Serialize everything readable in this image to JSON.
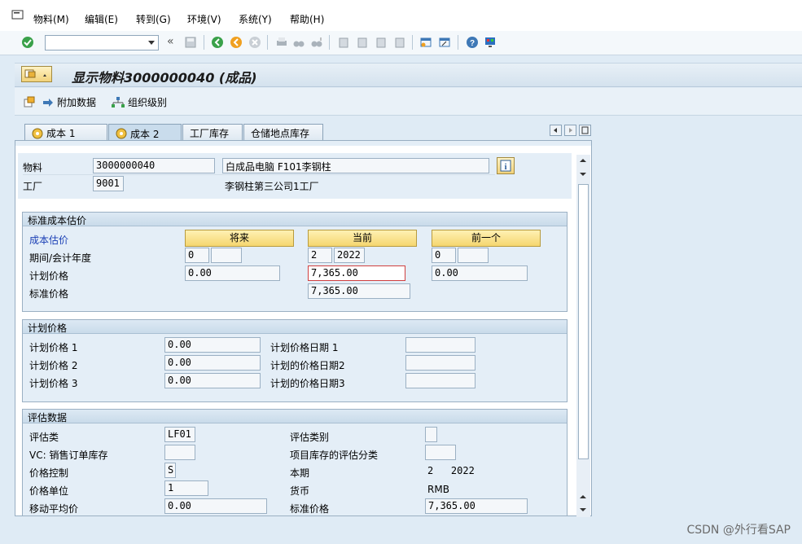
{
  "menu": [
    "物料(M)",
    "编辑(E)",
    "转到(G)",
    "环境(V)",
    "系统(Y)",
    "帮助(H)"
  ],
  "toolbar": {
    "command_value": ""
  },
  "title": "显示物料3000000040 (成品)",
  "appbar": {
    "additional_data": "附加数据",
    "org_levels": "组织级别"
  },
  "tabs": [
    "成本 1",
    "成本 2",
    "工厂库存",
    "仓储地点库存"
  ],
  "active_tab": "成本 2",
  "header": {
    "material_label": "物料",
    "material_value": "3000000040",
    "material_desc": "白成品电脑 F101李钢柱",
    "plant_label": "工厂",
    "plant_value": "9001",
    "plant_desc": "李钢柱第三公司1工厂"
  },
  "std_cost": {
    "group_title": "标准成本估价",
    "cost_estimate_label": "成本估价",
    "future_btn": "将来",
    "current_btn": "当前",
    "previous_btn": "前一个",
    "period_label": "期间/会计年度",
    "future_period": "0",
    "future_year": "",
    "current_period": "2",
    "current_year": "2022",
    "previous_period": "0",
    "previous_year": "",
    "planned_price_label": "计划价格",
    "future_planned": "0.00",
    "current_planned": "7,365.00",
    "previous_planned": "0.00",
    "std_price_label": "标准价格",
    "current_std": "7,365.00"
  },
  "planned": {
    "group_title": "计划价格",
    "p1_label": "计划价格 1",
    "p1_value": "0.00",
    "d1_label": "计划价格日期 1",
    "d1_value": "",
    "p2_label": "计划价格 2",
    "p2_value": "0.00",
    "d2_label": "计划的价格日期2",
    "d2_value": "",
    "p3_label": "计划价格 3",
    "p3_value": "0.00",
    "d3_label": "计划的价格日期3",
    "d3_value": ""
  },
  "valuation": {
    "group_title": "评估数据",
    "val_class_label": "评估类",
    "val_class_value": "LF01",
    "val_cat_label": "评估类别",
    "val_cat_value": "",
    "vc_label": "VC: 销售订单库存",
    "vc_value": "",
    "proj_label": "项目库存的评估分类",
    "proj_value": "",
    "price_ctrl_label": "价格控制",
    "price_ctrl_value": "S",
    "cur_period_label": "本期",
    "cur_period_value": "2   2022",
    "price_unit_label": "价格单位",
    "price_unit_value": "1",
    "currency_label": "货币",
    "currency_value": "RMB",
    "mov_avg_label": "移动平均价",
    "mov_avg_value": "0.00",
    "std_price_label": "标准价格",
    "std_price_value": "7,365.00"
  },
  "watermark": "CSDN @外行看SAP",
  "colors": {
    "accent": "#f5d66f",
    "panel": "#e4eef7",
    "label_blue": "#1a3fb5"
  }
}
